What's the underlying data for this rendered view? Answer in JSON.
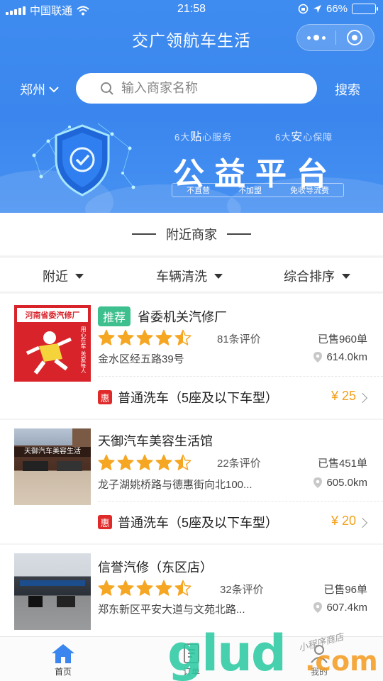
{
  "status_bar": {
    "carrier": "中国联通",
    "time": "21:58",
    "battery": "66%",
    "battery_level": 0.66
  },
  "header": {
    "title": "交广领航车生活"
  },
  "search": {
    "city": "郑州",
    "placeholder": "输入商家名称",
    "button": "搜索"
  },
  "banner": {
    "service_left_num": "6大",
    "service_left_em": "贴",
    "service_left_rest": "心服务",
    "service_right_num": "6大",
    "service_right_em": "安",
    "service_right_rest": "心保障",
    "headline": "公益平台",
    "tags": [
      "不直营",
      "不加盟",
      "免收导流费"
    ]
  },
  "section": {
    "title": "附近商家"
  },
  "filters": [
    "附近",
    "车辆清洗",
    "综合排序"
  ],
  "merchants": [
    {
      "recommended": "推荐",
      "name": "省委机关汽修厂",
      "rating": 4.5,
      "reviews": "81条评价",
      "sold": "已售960单",
      "address": "金水区经五路39号",
      "distance": "614.0km",
      "service_badge": "惠",
      "service": "普通洗车（5座及以下车型）",
      "price": "¥ 25",
      "thumb_sign": "河南省委汽修厂",
      "thumb_slogan": "用心在车 关爱每人"
    },
    {
      "name": "天御汽车美容生活馆",
      "rating": 4.5,
      "reviews": "22条评价",
      "sold": "已售451单",
      "address": "龙子湖姚桥路与德惠街向北100...",
      "distance": "605.0km",
      "service_badge": "惠",
      "service": "普通洗车（5座及以下车型）",
      "price": "¥ 20",
      "thumb_sign": "天御汽车美容生活"
    },
    {
      "name": "信誉汽修（东区店）",
      "rating": 4.5,
      "reviews": "32条评价",
      "sold": "已售96单",
      "address": "郑东新区平安大道与文苑北路...",
      "distance": "607.4km"
    }
  ],
  "tabs": [
    "首页",
    "订单",
    "我的"
  ],
  "watermark": {
    "main": "glud",
    "suffix": ".com",
    "note": "小程序商店"
  },
  "colors": {
    "primary": "#3a86ee",
    "recommend": "#3dbf8e",
    "star": "#f5a623",
    "price": "#f3a01a",
    "badge": "#e02a2a"
  }
}
